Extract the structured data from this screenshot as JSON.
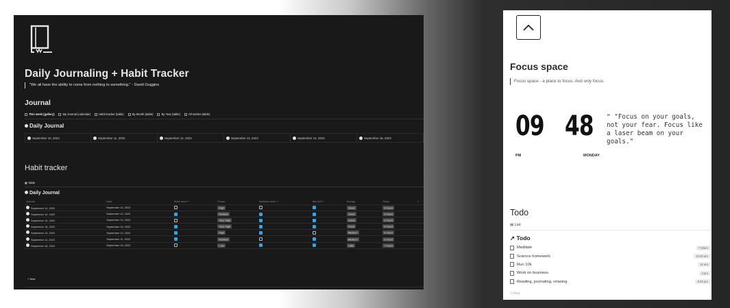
{
  "left_panel": {
    "title": "Daily Journaling + Habit Tracker",
    "quote": "\"We all have the ability to come from nothing to something.\" - David Goggins",
    "journal_heading": "Journal",
    "views": [
      "This week (gallery)",
      "My Journal (calendar)",
      "Habit tracker (table)",
      "By Month (table)",
      "By Year (table)",
      "All entries (table)"
    ],
    "daily_journal_db": "Daily Journal",
    "gallery_cards": [
      "September 10, 2022",
      "September 11, 2022",
      "September 12, 2022",
      "September 13, 2022",
      "September 14, 2022",
      "September 15, 2022"
    ],
    "habit_heading": "Habit tracker",
    "table_tab": "Table",
    "habit_db": "Daily Journal",
    "columns": [
      "Journal",
      "Date",
      "Work done ?",
      "Focus",
      "Workout done ?",
      "Ate well ?",
      "Energy",
      "Sleep",
      "+"
    ],
    "rows": [
      {
        "journal": "September 10, 2022",
        "date": "September 10, 2022",
        "work": false,
        "focus": "High",
        "workout": false,
        "ate": true,
        "energy": "Great",
        "sleep": "8 hours"
      },
      {
        "journal": "September 12, 2022",
        "date": "September 12, 2022",
        "work": true,
        "focus": "Medium",
        "workout": true,
        "ate": true,
        "energy": "Great",
        "sleep": "8 hours"
      },
      {
        "journal": "September 14, 2022",
        "date": "September 14, 2022",
        "work": false,
        "focus": "Very High",
        "workout": true,
        "ate": true,
        "energy": "Great",
        "sleep": "8 hours"
      },
      {
        "journal": "September 15, 2022",
        "date": "September 15, 2022",
        "work": true,
        "focus": "Very High",
        "workout": true,
        "ate": true,
        "energy": "Good",
        "sleep": "8 hours"
      },
      {
        "journal": "September 13, 2022",
        "date": "September 13, 2022",
        "work": true,
        "focus": "High",
        "workout": true,
        "ate": false,
        "energy": "Medium",
        "sleep": "8 hours"
      },
      {
        "journal": "September 11, 2022",
        "date": "September 11, 2022",
        "work": true,
        "focus": "Medium",
        "workout": false,
        "ate": true,
        "energy": "Medium",
        "sleep": "8 hours"
      },
      {
        "journal": "September 16, 2022",
        "date": "September 16, 2022",
        "work": false,
        "focus": "Low",
        "workout": true,
        "ate": true,
        "energy": "Little",
        "sleep": "7 hours"
      }
    ],
    "new_label": "+ New"
  },
  "right_panel": {
    "title": "Focus space",
    "subtitle": "Focus space - a place to focus. And only focus.",
    "clock_hours": "09",
    "clock_minutes": "48",
    "clock_ampm": "PM",
    "clock_day": "MONDAY",
    "quote": "❝ \"Focus on your goals, not your fear. Focus like a laser beam on your goals.\"",
    "todo_heading": "Todo",
    "list_tab": "List",
    "todo_db": "↗ Todo",
    "todos": [
      {
        "label": "Meditate",
        "time": "7:30am"
      },
      {
        "label": "Science homework",
        "time": "10:30 am"
      },
      {
        "label": "Run 10k",
        "time": "12 am"
      },
      {
        "label": "Work on business",
        "time": "3 pm"
      },
      {
        "label": "Reading, journaling, relaxing",
        "time": "8:30 pm"
      }
    ],
    "new_label": "+ New"
  }
}
